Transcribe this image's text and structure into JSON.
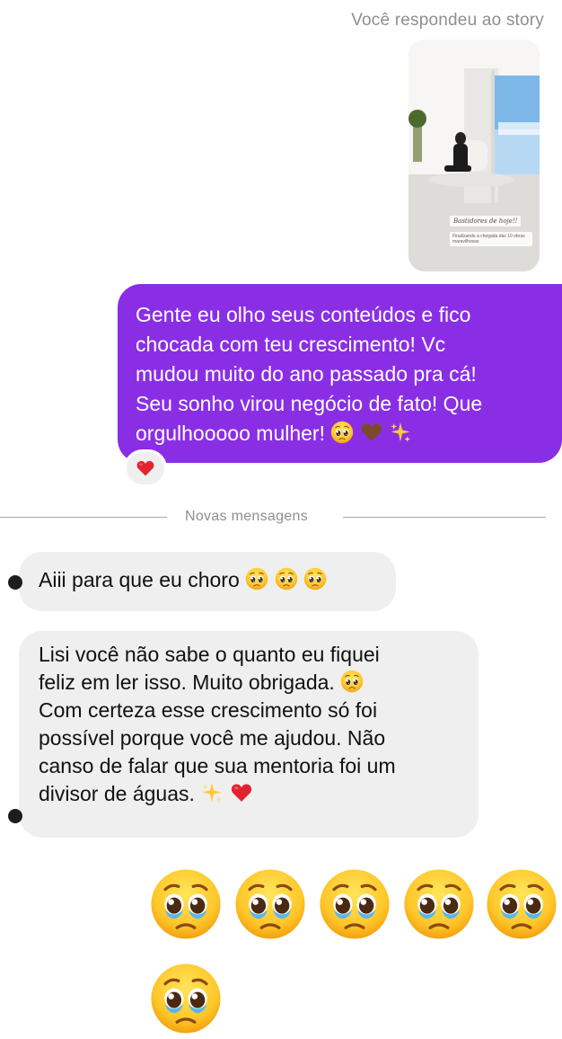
{
  "thread": {
    "reply_caption": "Você respondeu ao story",
    "story": {
      "caption": "Bastidores de hoje!!",
      "subcaption": "Finalizando a chegada das 10 obras maravilhosas"
    },
    "outgoing_message": {
      "lines": [
        "Gente eu olho seus conteúdos e fico",
        "chocada com teu crescimento! Vc",
        "mudou muito do ano passado pra cá!",
        "Seu sonho virou negócio de fato! Que",
        "orgulhooooo mulher!"
      ],
      "trailing_emojis": [
        "pleading-face",
        "brown-heart",
        "sparkles"
      ],
      "reaction": "red-heart"
    },
    "divider_label": "Novas mensagens",
    "incoming_messages": [
      {
        "lines": [
          "Aiii para que eu choro"
        ],
        "trailing_emojis": [
          "pleading-face",
          "pleading-face",
          "pleading-face"
        ]
      },
      {
        "lines": [
          "Lisi você não sabe o quanto eu fiquei",
          "feliz em ler isso. Muito obrigada.",
          "Com certeza esse crescimento só foi",
          "possível porque você me ajudou. Não",
          "canso de falar que sua mentoria foi um",
          "divisor de águas."
        ]
      }
    ],
    "big_emojis": [
      "crying-pleading-face",
      "crying-pleading-face",
      "crying-pleading-face",
      "crying-pleading-face",
      "crying-pleading-face",
      "crying-pleading-face"
    ]
  },
  "colors": {
    "outgoing_bubble": "#8a2ee6",
    "incoming_bubble": "#efefef",
    "muted_text": "#8e8e93",
    "reaction_heart": "#e0242f"
  }
}
